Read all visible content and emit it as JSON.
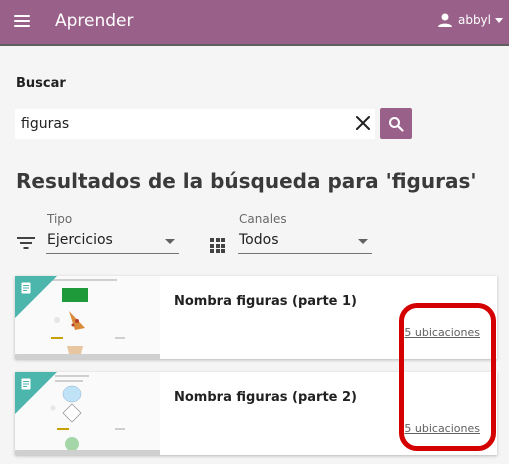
{
  "appbar": {
    "title": "Aprender",
    "username": "abbyl",
    "color": "#996189"
  },
  "search": {
    "label": "Buscar",
    "value": "figuras",
    "icon": "search-icon",
    "clear_icon": "close-icon"
  },
  "results": {
    "heading": "Resultados de la búsqueda para 'figuras'"
  },
  "filters": {
    "type": {
      "label": "Tipo",
      "value": "Ejercicios",
      "icon": "filter-icon"
    },
    "channels": {
      "label": "Canales",
      "value": "Todos",
      "icon": "grid-icon"
    }
  },
  "cards": [
    {
      "title": "Nombra figuras (parte 1)",
      "link": "5 ubicaciones",
      "kind_icon": "exercise-icon",
      "accent": "#4db6ac"
    },
    {
      "title": "Nombra figuras (parte 2)",
      "link": "5 ubicaciones",
      "kind_icon": "exercise-icon",
      "accent": "#4db6ac"
    }
  ],
  "annotation": {
    "color": "#d40000"
  }
}
